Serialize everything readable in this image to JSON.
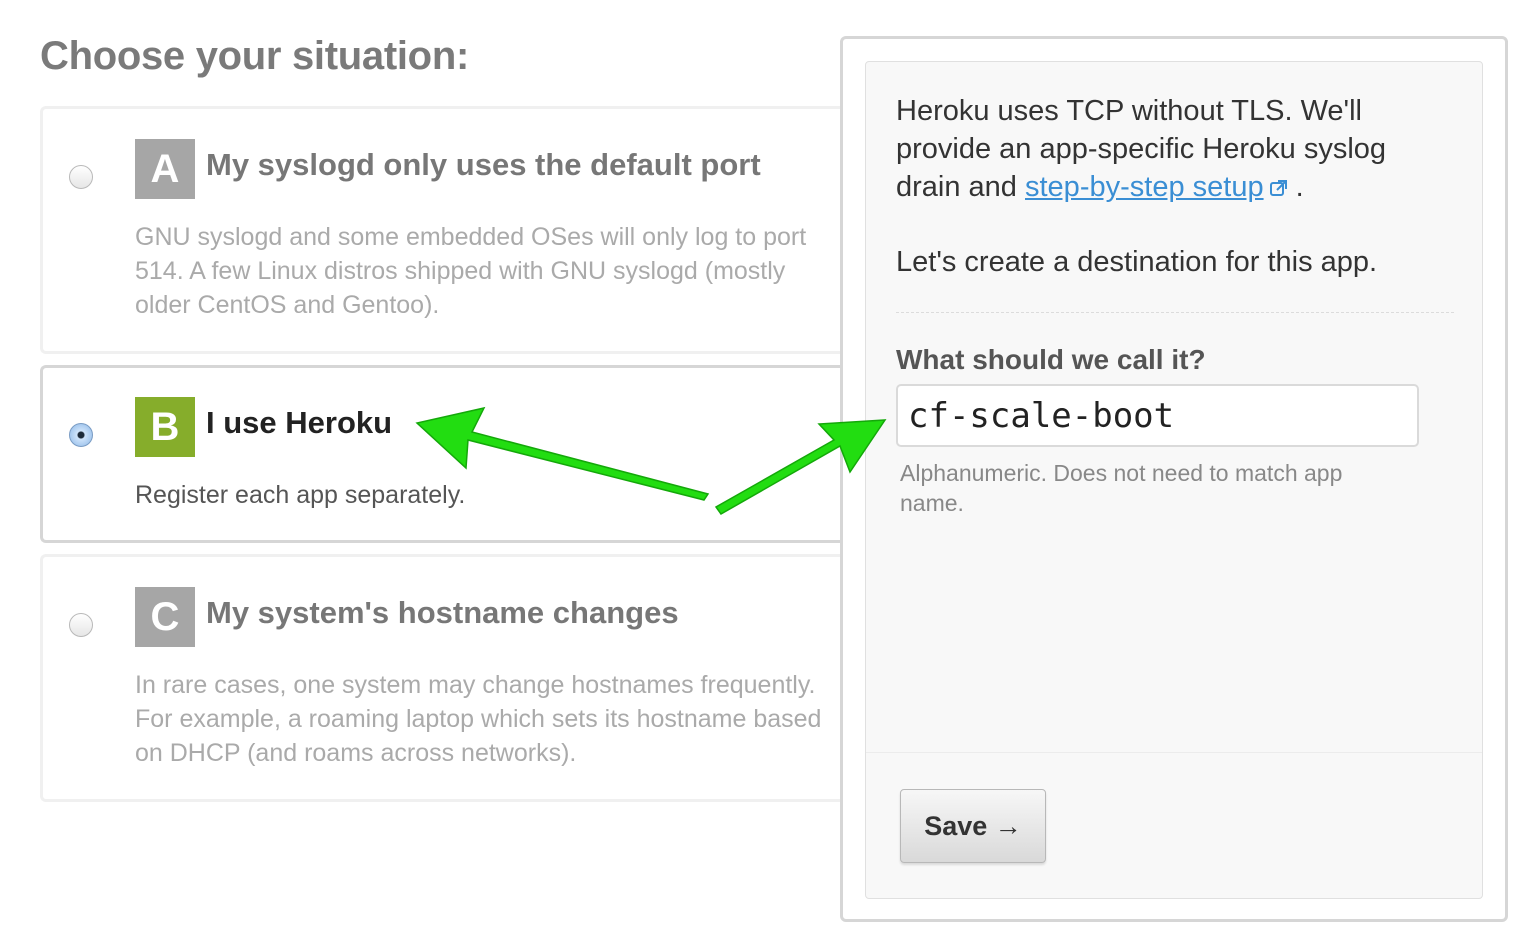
{
  "page": {
    "heading": "Choose your situation:"
  },
  "options": [
    {
      "letter": "A",
      "title": "My syslogd only uses the default port",
      "description": "GNU syslogd and some embedded OSes will only log to port 514. A few Linux distros shipped with GNU syslogd (mostly older CentOS and Gentoo).",
      "selected": false,
      "badge_color": "#a6a6a6"
    },
    {
      "letter": "B",
      "title": "I use Heroku",
      "description": "Register each app separately.",
      "selected": true,
      "badge_color": "#86ad2b"
    },
    {
      "letter": "C",
      "title": "My system's hostname changes",
      "description": "In rare cases, one system may change hostnames frequently. For example, a roaming laptop which sets its hostname based on DHCP (and roams across networks).",
      "selected": false,
      "badge_color": "#a6a6a6"
    }
  ],
  "panel": {
    "intro_before_link": "Heroku uses TCP without TLS. We'll provide an app-specific Heroku syslog drain and ",
    "link_text": "step-by-step setup",
    "link_icon": "external-link-icon",
    "intro_after_link": " .",
    "create_text": "Let's create a destination for this app.",
    "field_label": "What should we call it?",
    "field_value": "cf-scale-boot",
    "hint": "Alphanumeric. Does not need to match app name.",
    "save_label": "Save →"
  },
  "annotation": {
    "arrow_color": "#22dd11",
    "icon": "green-arrows"
  },
  "colors": {
    "link": "#3a8ed4"
  }
}
